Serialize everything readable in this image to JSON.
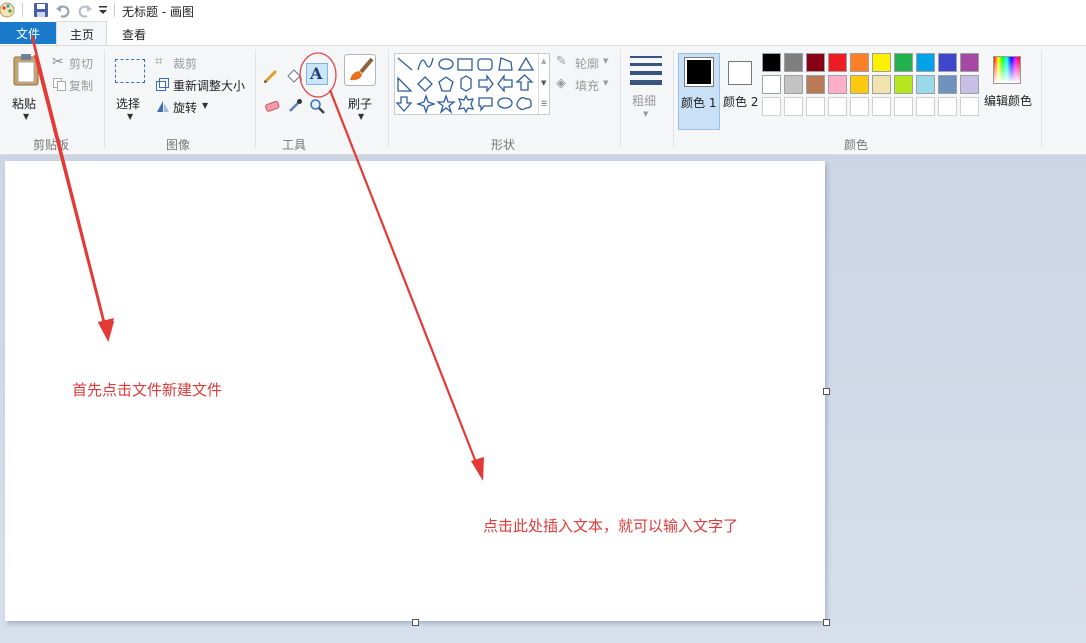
{
  "window": {
    "title": "无标题 - 画图"
  },
  "tabs": [
    {
      "label": "文件",
      "active_menu": true
    },
    {
      "label": "主页",
      "selected": true
    },
    {
      "label": "查看"
    }
  ],
  "groups": {
    "clipboard": {
      "label": "剪贴板",
      "paste": "粘贴",
      "cut": "剪切",
      "copy": "复制"
    },
    "image": {
      "label": "图像",
      "select": "选择",
      "crop": "裁剪",
      "resize": "重新调整大小",
      "rotate": "旋转"
    },
    "tools": {
      "label": "工具",
      "brushes": "刷子"
    },
    "shapes": {
      "label": "形状",
      "outline": "轮廓",
      "fill": "填充"
    },
    "size": {
      "label": "粗细"
    },
    "colors": {
      "label": "颜色",
      "color1": "颜色 1",
      "color2": "颜色 2",
      "edit": "编辑颜色",
      "color1_value": "#000000",
      "color2_value": "#ffffff",
      "palette_row1": [
        "#000000",
        "#7f7f7f",
        "#880015",
        "#ed1c24",
        "#ff7f27",
        "#fff200",
        "#22b14c",
        "#00a2e8",
        "#3f48cc",
        "#a349a4"
      ],
      "palette_row2": [
        "#ffffff",
        "#c3c3c3",
        "#b97a57",
        "#ffaec9",
        "#ffc90e",
        "#efe4b0",
        "#b5e61d",
        "#99d9ea",
        "#7092be",
        "#c8bfe7"
      ]
    }
  },
  "annotations": {
    "note1": "首先点击文件新建文件",
    "note2": "点击此处插入文本，就可以输入文字了",
    "color": "#e03a3a"
  }
}
